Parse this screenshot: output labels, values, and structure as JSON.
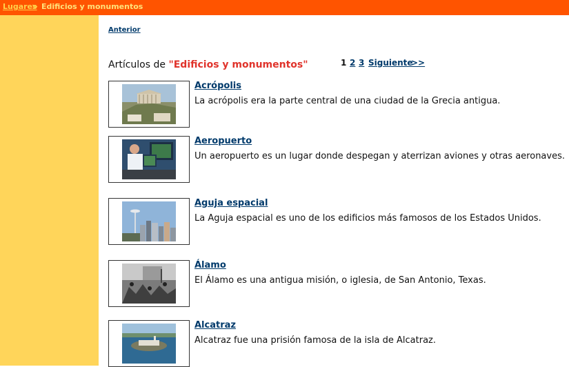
{
  "breadcrumb": {
    "parent": "Lugares",
    "separator": ">",
    "current": "Edificios y monumentos"
  },
  "nav": {
    "previous": "Anterior"
  },
  "heading": {
    "prefix": "Artículos de",
    "category": "\"Edificios y monumentos\""
  },
  "pagination": {
    "current": "1",
    "page2": "2",
    "page3": "3",
    "next": "Siguiente",
    "last": ">>"
  },
  "articles": [
    {
      "title": "Acrópolis",
      "description": "La acrópolis era la parte central de una ciudad de la Grecia antigua.",
      "image": "acropolis-photo"
    },
    {
      "title": "Aeropuerto",
      "description": "Un aeropuerto es un lugar donde despegan y aterrizan aviones y otras aeronaves.",
      "image": "air-traffic-control-photo"
    },
    {
      "title": "Aguja espacial",
      "description": "La Aguja espacial es uno de los edificios más famosos de los Estados Unidos.",
      "image": "space-needle-photo"
    },
    {
      "title": "Álamo",
      "description": "El Álamo es una antigua misión, o iglesia, de San Antonio, Texas.",
      "image": "alamo-battle-illustration"
    },
    {
      "title": "Alcatraz",
      "description": "Alcatraz fue una prisión famosa de la isla de Alcatraz.",
      "image": "alcatraz-island-photo"
    }
  ],
  "colors": {
    "topbar": "#ff5400",
    "sidebar": "#ffd55a",
    "link": "#003a6b",
    "category": "#e0332b"
  }
}
